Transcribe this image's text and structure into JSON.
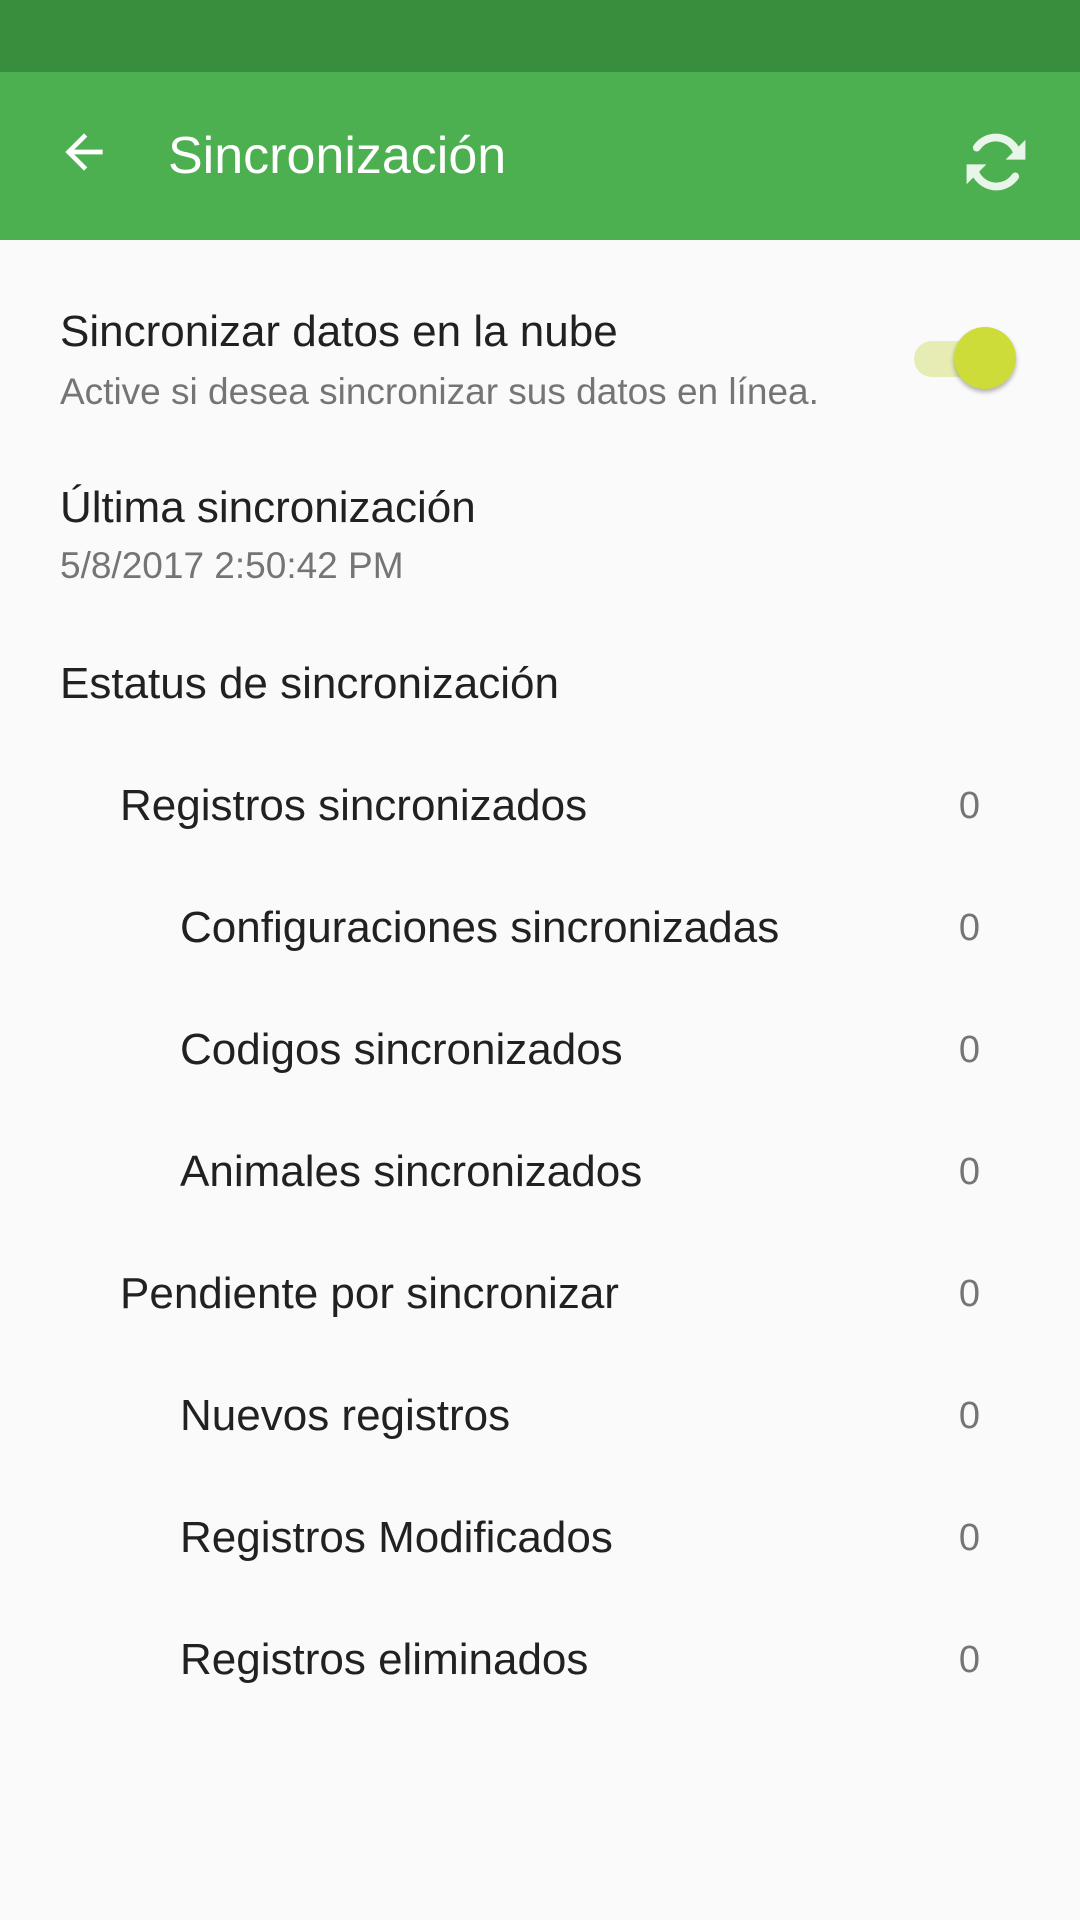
{
  "app_bar": {
    "title": "Sincronización",
    "back_icon": "arrow-back-icon",
    "sync_icon": "sync-icon",
    "color": "#4caf50",
    "status_bar_color": "#388e3c"
  },
  "cloud_sync": {
    "title": "Sincronizar datos en la nube",
    "summary": "Active si desea sincronizar sus datos en línea.",
    "enabled": true,
    "accent": "#cddc39"
  },
  "last_sync": {
    "title": "Última sincronización",
    "value": "5/8/2017 2:50:42 PM"
  },
  "status": {
    "title": "Estatus de sincronización",
    "synced": {
      "label": "Registros sincronizados",
      "value": "0",
      "items": [
        {
          "label": "Configuraciones sincronizadas",
          "value": "0"
        },
        {
          "label": "Codigos sincronizados",
          "value": "0"
        },
        {
          "label": "Animales sincronizados",
          "value": "0"
        }
      ]
    },
    "pending": {
      "label": "Pendiente por sincronizar",
      "value": "0",
      "items": [
        {
          "label": "Nuevos registros",
          "value": "0"
        },
        {
          "label": "Registros Modificados",
          "value": "0"
        },
        {
          "label": "Registros eliminados",
          "value": "0"
        }
      ]
    }
  }
}
